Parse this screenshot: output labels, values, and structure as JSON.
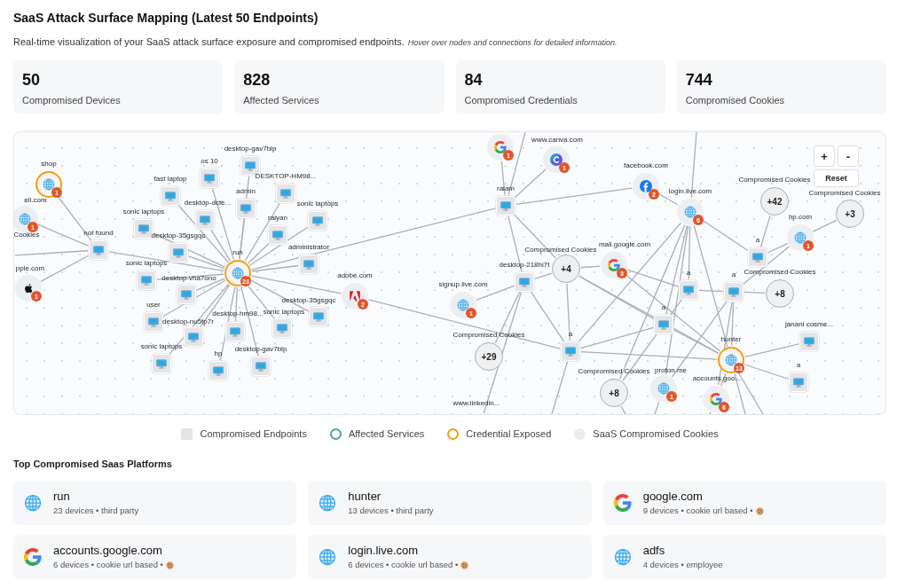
{
  "header": {
    "title": "SaaS Attack Surface Mapping (Latest 50 Endpoints)",
    "description": "Real-time visualization of your SaaS attack surface exposure and compromised endpoints.",
    "hint": "Hover over nodes and connections for detailed information."
  },
  "stats": [
    {
      "value": "50",
      "label": "Compromised Devices"
    },
    {
      "value": "828",
      "label": "Affected Services"
    },
    {
      "value": "84",
      "label": "Compromised Credentials"
    },
    {
      "value": "744",
      "label": "Compromised Cookies"
    }
  ],
  "graph": {
    "nodes": [
      {
        "kind": "credential",
        "label": "shop",
        "count": "1"
      },
      {
        "kind": "service",
        "label": "ell.com",
        "count": "1"
      },
      {
        "kind": "offscreen",
        "label": "Cookies"
      },
      {
        "kind": "service",
        "label": "pple.com",
        "count": "1"
      },
      {
        "kind": "endpoint",
        "label": "not found"
      },
      {
        "kind": "endpoint",
        "label": "sonic laptops"
      },
      {
        "kind": "endpoint",
        "label": "fast laptop"
      },
      {
        "kind": "endpoint",
        "label": "os 10"
      },
      {
        "kind": "endpoint",
        "label": "desktop-gav7blp"
      },
      {
        "kind": "endpoint",
        "label": "desktop-dcte..."
      },
      {
        "kind": "endpoint",
        "label": "admin"
      },
      {
        "kind": "endpoint",
        "label": "DESKTOP-HM98..."
      },
      {
        "kind": "endpoint",
        "label": "desktop-35gsgqc"
      },
      {
        "kind": "endpoint",
        "label": "raiyan"
      },
      {
        "kind": "endpoint",
        "label": "sonic laptops"
      },
      {
        "kind": "endpoint",
        "label": "administrator"
      },
      {
        "kind": "endpoint",
        "label": "sonic laptops"
      },
      {
        "kind": "endpoint",
        "label": "desktop-vha7ono"
      },
      {
        "kind": "credential",
        "label": "run",
        "count": "23"
      },
      {
        "kind": "endpoint",
        "label": "user"
      },
      {
        "kind": "endpoint",
        "label": "desktop-nu5fp7r"
      },
      {
        "kind": "endpoint",
        "label": "desktop-hm98..."
      },
      {
        "kind": "endpoint",
        "label": "sonic laptops"
      },
      {
        "kind": "endpoint",
        "label": "desktop-35gsgqc"
      },
      {
        "kind": "service",
        "label": "adobe.com",
        "count": "2"
      },
      {
        "kind": "endpoint",
        "label": "sonic laptops"
      },
      {
        "kind": "endpoint",
        "label": "hp"
      },
      {
        "kind": "endpoint",
        "label": "desktop-gav7blp"
      },
      {
        "kind": "service",
        "count": "1"
      },
      {
        "kind": "service",
        "label": "www.canva.com",
        "count": "1"
      },
      {
        "kind": "endpoint",
        "label": "ralam"
      },
      {
        "kind": "service",
        "label": "facebook.com",
        "count": "2"
      },
      {
        "kind": "service",
        "label": "login.live.com",
        "count": "6"
      },
      {
        "kind": "cookies",
        "label": "Compromised Cookies",
        "count": "+42"
      },
      {
        "kind": "cookies",
        "label": "Compromised Cookies",
        "count": "+3"
      },
      {
        "kind": "service",
        "label": "hp.com",
        "count": "1"
      },
      {
        "kind": "endpoint",
        "label": "a"
      },
      {
        "kind": "cookies",
        "label": "Compromised Cookies",
        "count": "+4"
      },
      {
        "kind": "service",
        "label": "mail.google.com",
        "count": "3"
      },
      {
        "kind": "endpoint",
        "label": "desktop-218hi7t"
      },
      {
        "kind": "service",
        "label": "signup.live.com",
        "count": "1"
      },
      {
        "kind": "endpoint",
        "label": "a"
      },
      {
        "kind": "endpoint",
        "label": "a"
      },
      {
        "kind": "cookies",
        "label": "Compromised Cookies",
        "count": "+8"
      },
      {
        "kind": "endpoint",
        "label": "a"
      },
      {
        "kind": "cookies",
        "label": "Compromised Cookies",
        "count": "+29"
      },
      {
        "kind": "endpoint",
        "label": "a"
      },
      {
        "kind": "credential",
        "label": "hunter",
        "count": "13"
      },
      {
        "kind": "endpoint",
        "label": "janani cosme..."
      },
      {
        "kind": "endpoint",
        "label": "a"
      },
      {
        "kind": "cookies",
        "label": "Compromised Cookies",
        "count": "+8"
      },
      {
        "kind": "service",
        "label": "proton.me",
        "count": "1"
      },
      {
        "kind": "service",
        "label": "accounts.goo...",
        "count": "6"
      },
      {
        "kind": "offscreen",
        "label": "www.linkedin..."
      }
    ],
    "controls": [
      {
        "label": "+"
      },
      {
        "label": "-"
      },
      {
        "label": "Reset"
      }
    ]
  },
  "legend": [
    {
      "label": "Compromised Endpoints",
      "kind": "square",
      "color": "#e2e4e8"
    },
    {
      "label": "Affected Services",
      "kind": "ring",
      "color": "#4aa3a2"
    },
    {
      "label": "Credential Exposed",
      "kind": "ring",
      "color": "#f59e0b"
    },
    {
      "label": "SaaS Compromised Cookies",
      "kind": "disc",
      "color": "#ececef"
    }
  ],
  "platforms": {
    "title": "Top Compromised Saas Platforms",
    "items": [
      {
        "name": "run",
        "details": "23 devices • third party",
        "cookie": false
      },
      {
        "name": "hunter",
        "details": "13 devices • third party",
        "cookie": false
      },
      {
        "name": "google.com",
        "details": "9 devices • cookie url based •",
        "cookie": true
      },
      {
        "name": "accounts.google.com",
        "details": "6 devices • cookie url based •",
        "cookie": true
      },
      {
        "name": "login.live.com",
        "details": "6 devices • cookie url based •",
        "cookie": true
      },
      {
        "name": "adfs",
        "details": "4 devices • employee",
        "cookie": false
      }
    ]
  }
}
